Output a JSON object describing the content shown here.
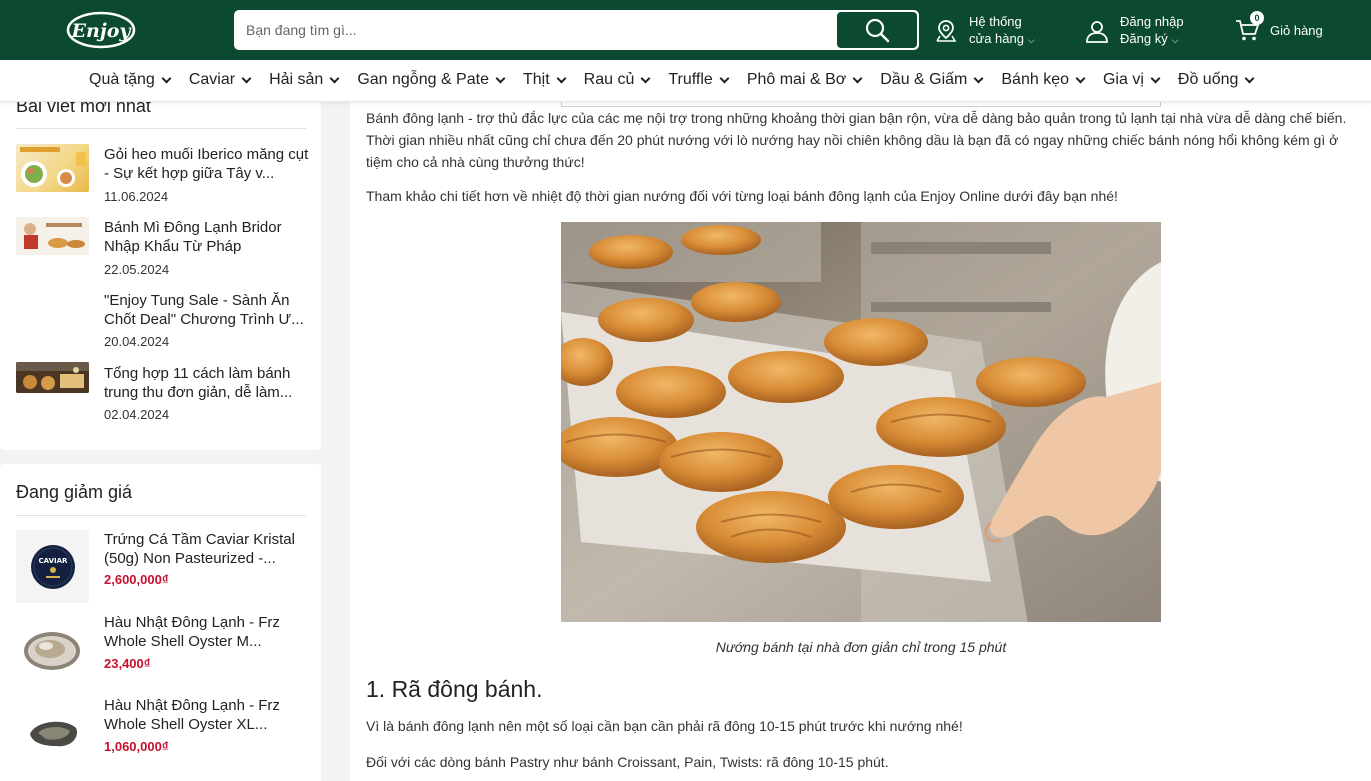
{
  "header": {
    "logo_text": "Enjoy",
    "search_placeholder": "Bạn đang tìm gì...",
    "store_line1": "Hệ thống",
    "store_line2": "cửa hàng",
    "login_line1": "Đăng nhập",
    "login_line2": "Đăng ký",
    "cart_label": "Giỏ hàng",
    "cart_count": "0"
  },
  "categories": [
    "Quà tặng",
    "Caviar",
    "Hải sản",
    "Gan ngỗng & Pate",
    "Thịt",
    "Rau củ",
    "Truffle",
    "Phô mai & Bơ",
    "Dầu & Giấm",
    "Bánh kẹo",
    "Gia vị",
    "Đồ uống"
  ],
  "sidebar": {
    "recent_title": "Bài viết mới nhất",
    "recent_posts": [
      {
        "title": "Gỏi heo muối Iberico măng cụt - Sự kết hợp giữa Tây v...",
        "date": "11.06.2024"
      },
      {
        "title": "Bánh Mì Đông Lạnh Bridor Nhập Khẩu Từ Pháp",
        "date": "22.05.2024"
      },
      {
        "title": "\"Enjoy Tung Sale - Sành Ăn Chốt Deal\" Chương Trình Ư...",
        "date": "20.04.2024"
      },
      {
        "title": "Tổng hợp 11 cách làm bánh trung thu đơn giản, dễ làm...",
        "date": "02.04.2024"
      }
    ],
    "sale_title": "Đang giảm giá",
    "sale_items": [
      {
        "title": "Trứng Cá Tầm Caviar Kristal (50g) Non Pasteurized -...",
        "price": "2,600,000₫",
        "label": "CAVIAR"
      },
      {
        "title": "Hàu Nhật Đông Lạnh - Frz Whole Shell Oyster M...",
        "price": "23,400₫"
      },
      {
        "title": "Hàu Nhật Đông Lạnh - Frz Whole Shell Oyster XL...",
        "price": "1,060,000₫"
      }
    ]
  },
  "article": {
    "intro": "Bánh đông lạnh - trợ thủ đắc lực của các mẹ nội trợ trong những khoảng thời gian bận rộn, vừa dễ dàng bảo quản trong tủ lạnh tại nhà vừa dễ dàng chế biến. Thời gian nhiều nhất cũng chỉ chưa đến 20 phút nướng với lò nướng hay nồi chiên không dầu là bạn đã có ngay những chiếc bánh nóng hổi không kém gì ở tiệm cho cả nhà cùng thưởng thức!",
    "reference": "Tham khảo chi tiết hơn về nhiệt độ thời gian nướng đối với từng loại bánh đông lạnh của Enjoy Online dưới đây bạn nhé!",
    "caption": "Nướng bánh tại nhà đơn giản chỉ trong 15 phút",
    "section1_title": "1. Rã đông bánh.",
    "section1_p1": "Vì là bánh đông lạnh nên một số loại cần bạn cần phải rã đông 10-15 phút trước khi nướng nhé!",
    "section1_p2": "Đối với các dòng bánh Pastry như bánh Croissant, Pain, Twists: rã đông 10-15 phút."
  },
  "colors": {
    "brand_green": "#0b4a30",
    "price_red": "#c8102e"
  }
}
